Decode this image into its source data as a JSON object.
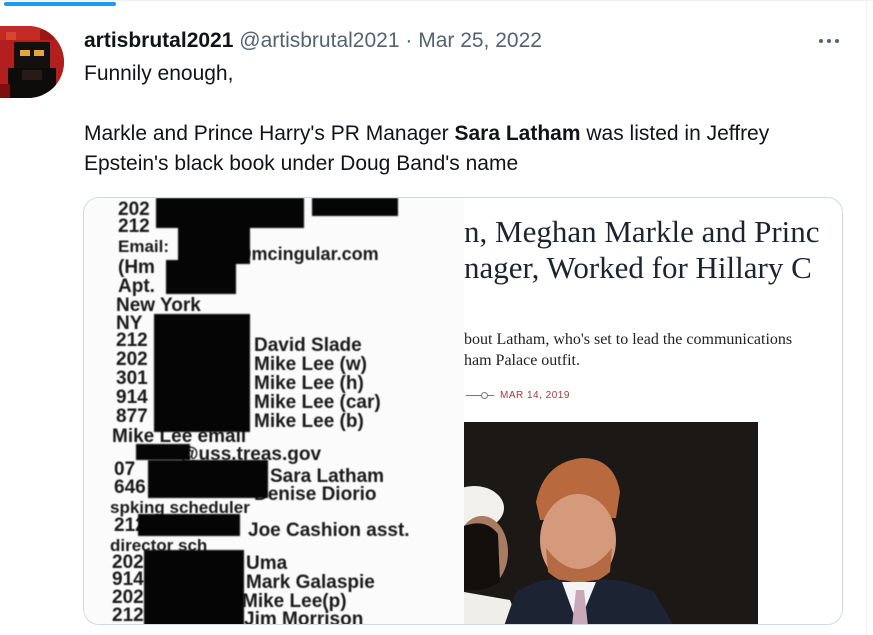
{
  "tweet": {
    "display_name": "artisbrutal2021",
    "handle": "@artisbrutal2021",
    "separator": "·",
    "date": "Mar 25, 2022",
    "more_label": "More",
    "line1": "Funnily enough,",
    "line2_before": "Markle and Prince Harry's PR Manager ",
    "line2_bold": "Sara Latham",
    "line2_after": " was listed in Jeffrey",
    "line3": "Epstein's black book under Doug Band's name"
  },
  "media": {
    "left_image": {
      "lines": [
        "202",
        "212",
        "Email:",
        "@mcingular.com",
        "(Hm",
        "Apt.",
        "New York",
        "NY",
        "212",
        "David Slade",
        "202",
        "Mike Lee (w)",
        "301",
        "Mike Lee (h)",
        "914",
        "Mike Lee (car)",
        "877",
        "Mike Lee (b)",
        "Mike Lee email",
        "@uss.treas.gov",
        "07",
        "Sara Latham",
        "646",
        "Denise Diorio",
        "spking scheduler",
        "212",
        "Joe Cashion asst.",
        "director sch",
        "202",
        "Uma",
        "914",
        "Mark Galaspie",
        "202",
        "Mike Lee(p)",
        "212",
        "Jim Morrison"
      ]
    },
    "right_image": {
      "headline_line1": "n, Meghan Markle and Princ",
      "headline_line2": "nager, Worked for Hillary C",
      "lede_line1": "bout Latham, who's set to lead the communications",
      "lede_line2": "ham Palace outfit.",
      "date": "MAR 14, 2019"
    }
  },
  "colors": {
    "accent": "#1d9bf0",
    "meta_gray": "#536471",
    "text": "#0f1419",
    "border": "#cfd9de",
    "dateline": "#a33b3b"
  },
  "icons": {
    "more": "more-horizontal-icon"
  }
}
